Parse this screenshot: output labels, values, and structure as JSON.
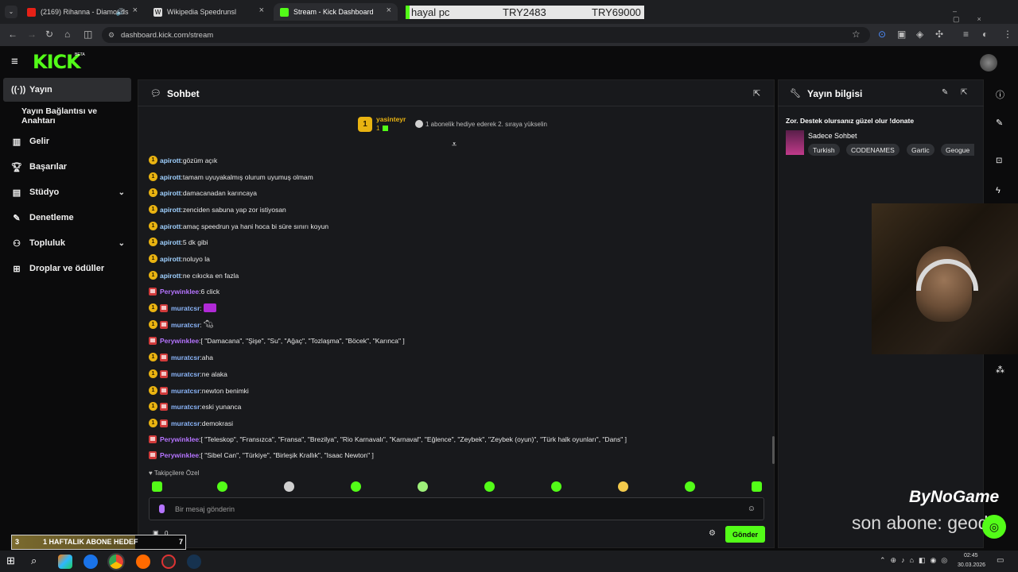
{
  "browser": {
    "tabs": [
      {
        "label": "(2169) Rihanna - Diamonds"
      },
      {
        "label": "Wikipedia Speedrunsl"
      },
      {
        "label": "Stream - Kick Dashboard"
      }
    ],
    "url": "dashboard.kick.com/stream"
  },
  "overlay_top": {
    "name": "hayal pc",
    "current": "TRY2483",
    "target": "TRY69000"
  },
  "header": {
    "logo": "KICK",
    "beta": "BETA"
  },
  "sidebar": {
    "items": [
      {
        "label": "Yayın"
      },
      {
        "label": "Yayın Bağlantısı ve Anahtarı"
      },
      {
        "label": "Gelir"
      },
      {
        "label": "Başarılar"
      },
      {
        "label": "Stüdyo"
      },
      {
        "label": "Denetleme"
      },
      {
        "label": "Topluluk"
      },
      {
        "label": "Droplar ve ödüller"
      }
    ]
  },
  "chat": {
    "title": "Sohbet",
    "pinned": {
      "badge": "1",
      "user": "yasinteyr",
      "count": "1",
      "text": "1 abonelik hediye ederek 2. sıraya yükselin"
    },
    "messages": [
      {
        "badges": [
          "sub"
        ],
        "user": "apirott",
        "text": "gözüm açık"
      },
      {
        "badges": [
          "sub"
        ],
        "user": "apirott",
        "text": "tamam uyuyakalmış olurum uyumuş olmam"
      },
      {
        "badges": [
          "sub"
        ],
        "user": "apirott",
        "text": "damacanadan karıncaya"
      },
      {
        "badges": [
          "sub"
        ],
        "user": "apirott",
        "text": "zenciden sabuna yap zor istiyosan"
      },
      {
        "badges": [
          "sub"
        ],
        "user": "apirott",
        "text": "amaç speedrun ya hani hoca bi süre sınırı koyun"
      },
      {
        "badges": [
          "sub"
        ],
        "user": "apirott",
        "text": "5 dk gibi"
      },
      {
        "badges": [
          "sub"
        ],
        "user": "apirott",
        "text": "noluyo la"
      },
      {
        "badges": [
          "sub"
        ],
        "user": "apirott",
        "text": "ne cıkıcka en fazla"
      },
      {
        "badges": [
          "gift"
        ],
        "user": "Perywinklee",
        "text": "6 click"
      },
      {
        "badges": [
          "sub",
          "gift"
        ],
        "user": "muratcsr",
        "text": ""
      },
      {
        "badges": [
          "sub",
          "gift"
        ],
        "user": "muratcsr",
        "text": ""
      },
      {
        "badges": [
          "gift"
        ],
        "user": "Perywinklee",
        "text": "[ \"Damacana\", \"Şişe\", \"Su\", \"Ağaç\", \"Tozlaşma\", \"Böcek\", \"Karınca\" ]"
      },
      {
        "badges": [
          "sub",
          "gift"
        ],
        "user": "muratcsr",
        "text": "aha"
      },
      {
        "badges": [
          "sub",
          "gift"
        ],
        "user": "muratcsr",
        "text": "ne alaka"
      },
      {
        "badges": [
          "sub",
          "gift"
        ],
        "user": "muratcsr",
        "text": "newton benimki"
      },
      {
        "badges": [
          "sub",
          "gift"
        ],
        "user": "muratcsr",
        "text": "eski yunanca"
      },
      {
        "badges": [
          "sub",
          "gift"
        ],
        "user": "muratcsr",
        "text": "demokrasi"
      },
      {
        "badges": [
          "gift"
        ],
        "user": "Perywinklee",
        "text": "[ \"Teleskop\", \"Fransızca\", \"Fransa\", \"Brezilya\", \"Rio Karnavalı\", \"Karnaval\", \"Eğlence\", \"Zeybek\", \"Zeybek (oyun)\", \"Türk halk oyunları\", \"Dans\" ]"
      },
      {
        "badges": [
          "gift"
        ],
        "user": "Perywinklee",
        "text": "[ \"Sibel Can\", \"Türkiye\", \"Birleşik Krallık\", \"Isaac Newton\" ]"
      }
    ],
    "followers_only": "Takipçilere Özel",
    "input_placeholder": "Bir mesaj gönderin",
    "send_label": "Gönder",
    "points": "0"
  },
  "stream_info": {
    "title": "Yayın bilgisi",
    "stream_title": "Zor. Destek olursanız güzel olur !donate",
    "category": "Sadece Sohbet",
    "tags": [
      "Turkish",
      "CODENAMES",
      "Gartic",
      "Geogue"
    ]
  },
  "overlays": {
    "goal_count": "3",
    "goal_label": "1 HAFTALIK ABONE HEDEF",
    "goal_target": "7",
    "brand": "ByNoGame",
    "last_sub": "son abone: geodk"
  },
  "taskbar": {
    "time": "02:45",
    "date": "30.03.2026"
  },
  "colors": {
    "accent": "#53fc18",
    "sub_badge": "#e9b311",
    "user_blue": "#9fd0ff",
    "user_purple": "#b574ff"
  }
}
